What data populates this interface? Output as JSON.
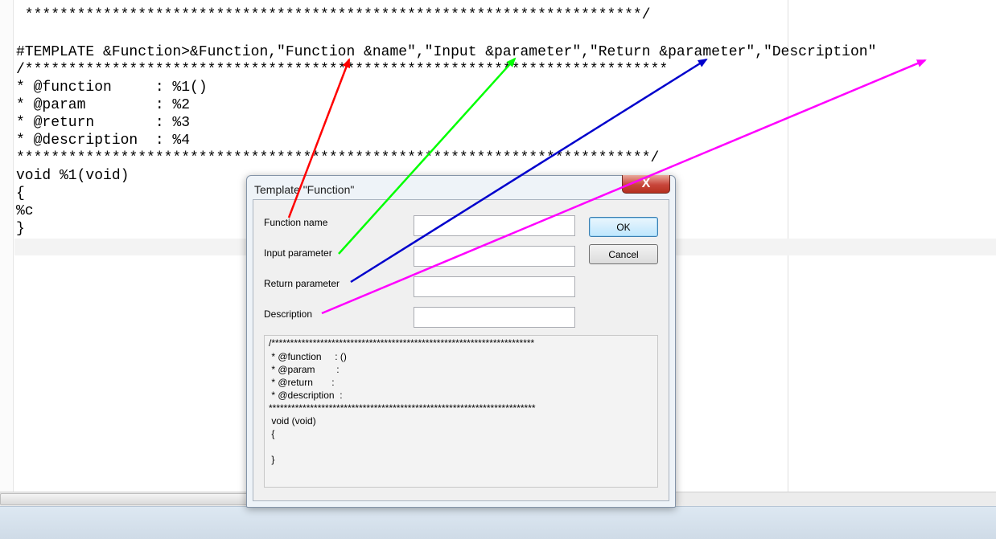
{
  "editor": {
    "lines": [
      " ***********************************************************************/",
      "",
      "#TEMPLATE &Function>&Function,\"Function &name\",\"Input &parameter\",\"Return &parameter\",\"Description\"",
      "/**************************************************************************",
      "* @function     : %1()",
      "* @param        : %2",
      "* @return       : %3",
      "* @description  : %4",
      "*************************************************************************/",
      "void %1(void)",
      "{",
      "%c",
      "}"
    ]
  },
  "dialog": {
    "title": "Template \"Function\"",
    "close_glyph": "X",
    "fields": [
      {
        "label": "Function name",
        "value": ""
      },
      {
        "label": "Input parameter",
        "value": ""
      },
      {
        "label": "Return parameter",
        "value": ""
      },
      {
        "label": "Description",
        "value": ""
      }
    ],
    "ok_label": "OK",
    "cancel_label": "Cancel",
    "preview_lines": [
      "/**********************************************************************",
      " * @function     : ()",
      " * @param        :",
      " * @return       :",
      " * @description  :",
      "***********************************************************************",
      " void (void)",
      " {",
      "",
      " }"
    ]
  },
  "arrow_colors": {
    "function_name": "#ff0000",
    "input_parameter": "#00ff00",
    "return_parameter": "#0000cc",
    "description": "#ff00ff"
  }
}
